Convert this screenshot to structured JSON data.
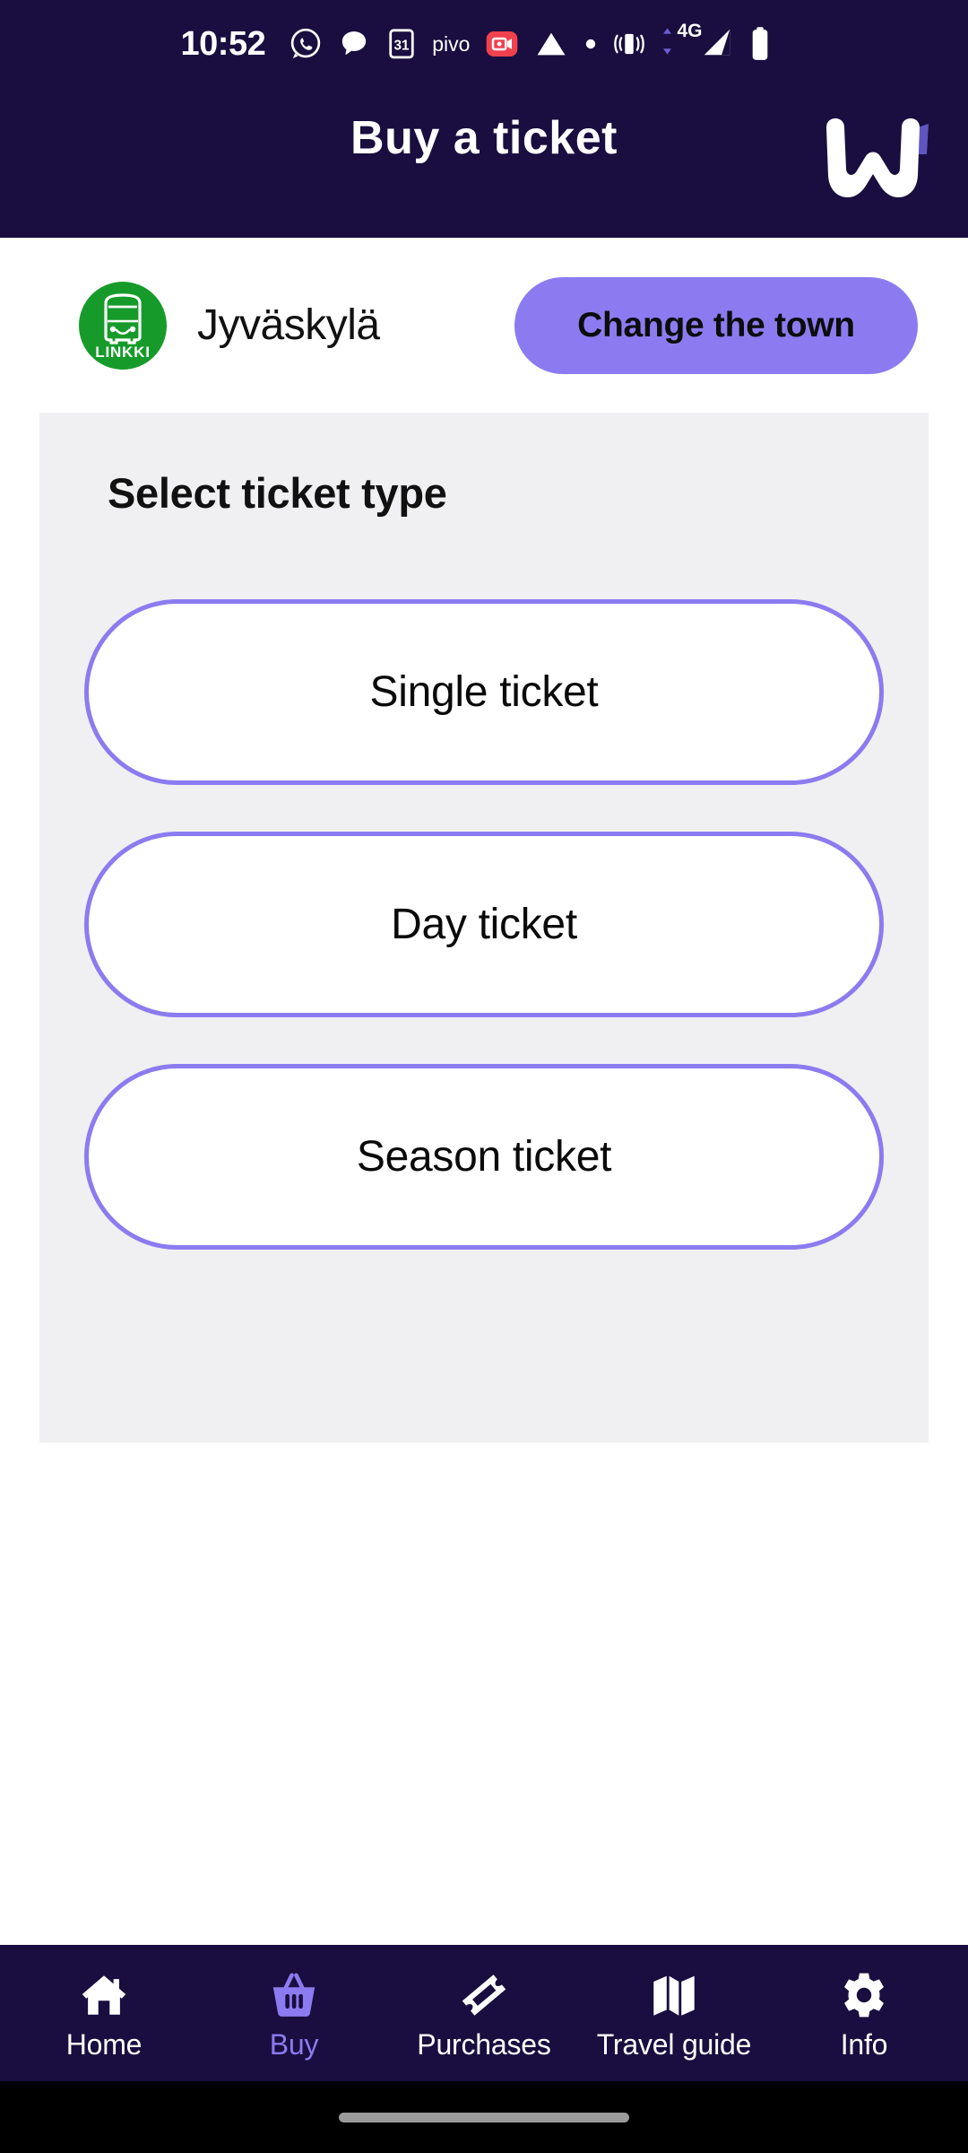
{
  "status_bar": {
    "time": "10:52",
    "pivo_label": "pivo",
    "network_label": "4G",
    "icons": [
      "whatsapp-icon",
      "messages-icon",
      "calendar-31-icon",
      "pivo-icon",
      "screen-recorder-icon",
      "triangle-icon",
      "dot-icon",
      "vibrate-icon",
      "signal-4g-icon",
      "battery-icon"
    ]
  },
  "header": {
    "title": "Buy a ticket",
    "logo_name": "waltti-w-logo",
    "background": "#190E3F"
  },
  "city_row": {
    "operator_badge_label": "LINKKI",
    "city": "Jyväskylä",
    "change_button_label": "Change the town",
    "badge_color": "#169B2A",
    "accent_color": "#8C7BF0"
  },
  "ticket_card": {
    "title": "Select ticket type",
    "background": "#F0F0F2",
    "options": [
      {
        "label": "Single ticket"
      },
      {
        "label": "Day ticket"
      },
      {
        "label": "Season ticket"
      }
    ]
  },
  "bottom_nav": {
    "active_index": 1,
    "items": [
      {
        "label": "Home",
        "icon": "home-icon"
      },
      {
        "label": "Buy",
        "icon": "basket-icon"
      },
      {
        "label": "Purchases",
        "icon": "ticket-icon"
      },
      {
        "label": "Travel guide",
        "icon": "map-icon"
      },
      {
        "label": "Info",
        "icon": "gear-icon"
      }
    ]
  }
}
